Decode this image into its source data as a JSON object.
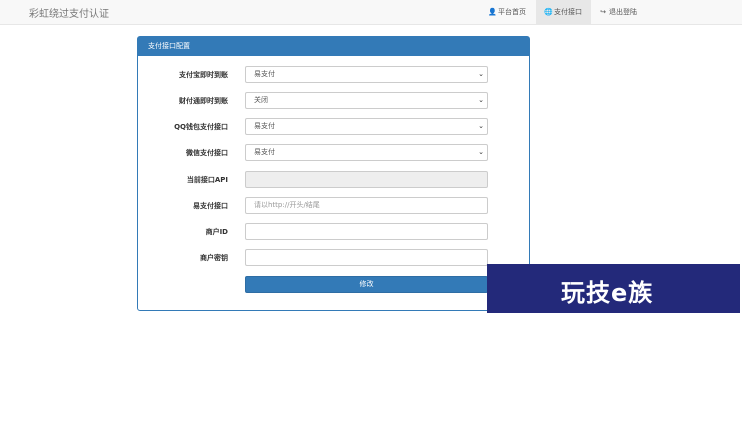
{
  "app": {
    "brand": "彩虹绕过支付认证"
  },
  "nav": {
    "items": [
      {
        "icon": "user-icon",
        "label": "平台首页"
      },
      {
        "icon": "globe-icon",
        "label": "支付接口"
      },
      {
        "icon": "logout-icon",
        "label": "退出登陆"
      }
    ]
  },
  "panel": {
    "title": "支付接口配置",
    "fields": [
      {
        "label": "支付宝即时到账",
        "type": "select",
        "value": "易支付"
      },
      {
        "label": "财付通即时到账",
        "type": "select",
        "value": "关闭"
      },
      {
        "label": "QQ钱包支付接口",
        "type": "select",
        "value": "易支付"
      },
      {
        "label": "微信支付接口",
        "type": "select",
        "value": "易支付"
      },
      {
        "label": "当前接口API",
        "type": "readonly",
        "value": ""
      },
      {
        "label": "易支付接口",
        "type": "text",
        "value": "",
        "placeholder": "请以http://开头/结尾"
      },
      {
        "label": "商户ID",
        "type": "text",
        "value": ""
      },
      {
        "label": "商户密钥",
        "type": "text",
        "value": ""
      }
    ],
    "submit_label": "修改"
  },
  "watermark": {
    "text": "玩技e族",
    "bg": "#23297a"
  }
}
